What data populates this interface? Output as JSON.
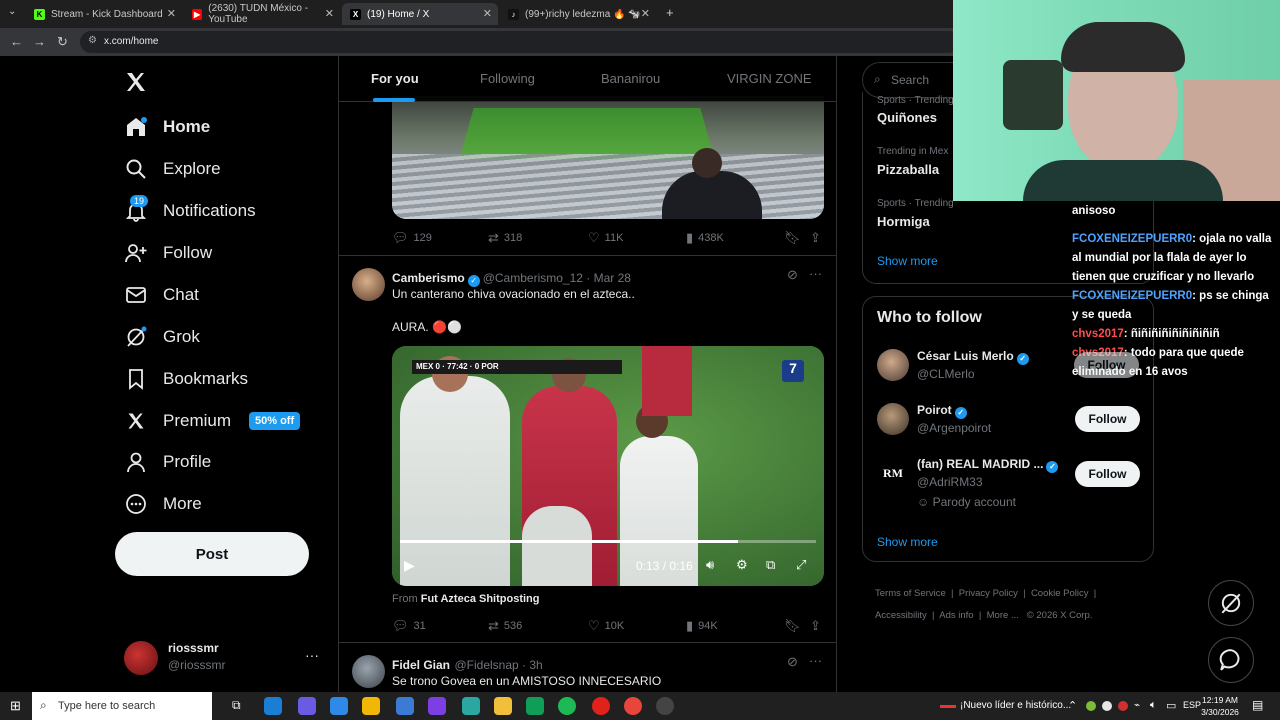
{
  "browser": {
    "tabs": [
      {
        "title": "Stream - Kick Dashboard",
        "fav_color": "#53fc18",
        "fav_glyph": "K"
      },
      {
        "title": "(2630) TUDN México - YouTube",
        "fav_color": "#ff0000",
        "fav_glyph": "▶"
      },
      {
        "title": "(19) Home / X",
        "fav_color": "#000000",
        "fav_glyph": "X"
      },
      {
        "title": "(99+)richy ledezma 🔥 🐄 мк |",
        "fav_color": "#111111",
        "fav_glyph": "♪"
      }
    ],
    "url": "x.com/home"
  },
  "nav": {
    "items": [
      {
        "label": "Home",
        "icon": "home-icon"
      },
      {
        "label": "Explore",
        "icon": "search-icon"
      },
      {
        "label": "Notifications",
        "icon": "bell-icon"
      },
      {
        "label": "Follow",
        "icon": "add-user-icon"
      },
      {
        "label": "Chat",
        "icon": "mail-icon"
      },
      {
        "label": "Grok",
        "icon": "grok-icon"
      },
      {
        "label": "Bookmarks",
        "icon": "bookmark-icon"
      },
      {
        "label": "Premium",
        "icon": "x-icon"
      },
      {
        "label": "Profile",
        "icon": "person-icon"
      },
      {
        "label": "More",
        "icon": "more-circle-icon"
      }
    ],
    "notifications_badge": "19",
    "premium_badge": "50% off",
    "post_label": "Post",
    "account": {
      "name": "riosssmr",
      "handle": "@riosssmr"
    }
  },
  "feed": {
    "tabs": [
      "For you",
      "Following",
      "Bananirou",
      "VIRGIN ZONE"
    ],
    "tweet1": {
      "replies": "129",
      "retweets": "318",
      "likes": "11K",
      "views": "438K"
    },
    "tweet2": {
      "name": "Camberismo",
      "handle": "@Camberismo_12",
      "date": "Mar 28",
      "text": "Un canterano chiva ovacionado en el azteca..",
      "text2": "AURA. 🔴⚪",
      "video_time": "0:13 / 0:16",
      "scoreboard": "MEX 0 · 77:42 · 0 POR",
      "from_label": "From",
      "from_source": "Fut Azteca Shitposting",
      "replies": "31",
      "retweets": "536",
      "likes": "10K",
      "views": "94K"
    },
    "tweet3": {
      "name": "Fidel Gian",
      "handle": "@Fidelsnap",
      "date": "3h",
      "text": "Se trono Govea en un AMISTOSO INNECESARIO"
    }
  },
  "right": {
    "search_placeholder": "Search",
    "trends": [
      {
        "meta": "Sports · Trending",
        "name": "Quiñones"
      },
      {
        "meta": "Trending in Mex",
        "name": "Pizzaballa"
      },
      {
        "meta": "Sports · Trending",
        "name": "Hormiga"
      }
    ],
    "show_more": "Show more",
    "who_to_follow": {
      "title": "Who to follow",
      "accounts": [
        {
          "name": "César Luis Merlo",
          "handle": "@CLMerlo",
          "follow": "Follow"
        },
        {
          "name": "Poirot",
          "handle": "@Argenpoirot",
          "follow": "Follow"
        },
        {
          "name": "(fan) REAL MADRID ...",
          "handle": "@AdriRM33",
          "note": "Parody account",
          "follow": "Follow"
        }
      ],
      "show_more": "Show more"
    },
    "footer": {
      "links": [
        "Terms of Service",
        "Privacy Policy",
        "Cookie Policy",
        "Accessibility",
        "Ads info",
        "More ..."
      ],
      "copyright": "© 2026 X Corp."
    }
  },
  "chat_overlay": {
    "partial_top": "anisoso",
    "messages": [
      {
        "user": "FCOXENEIZEPUERR0",
        "text": ": ojala no valla al mundial por la flala de ayer lo tienen que cruzificar y no llevarlo"
      },
      {
        "user": "FCOXENEIZEPUERR0",
        "text": ": ps se chinga y se queda"
      },
      {
        "user": "chvs2017",
        "text": ": ñiñiñiñiñiñiñiñiñ"
      },
      {
        "user": "chvs2017",
        "text": ": todo para que quede eliminado en 16 avos"
      }
    ]
  },
  "taskbar": {
    "search_placeholder": "Type here to search",
    "news": "¡Nuevo líder e histórico...",
    "lang": "ESP",
    "time": "12:19 AM",
    "date": "3/30/2026"
  }
}
